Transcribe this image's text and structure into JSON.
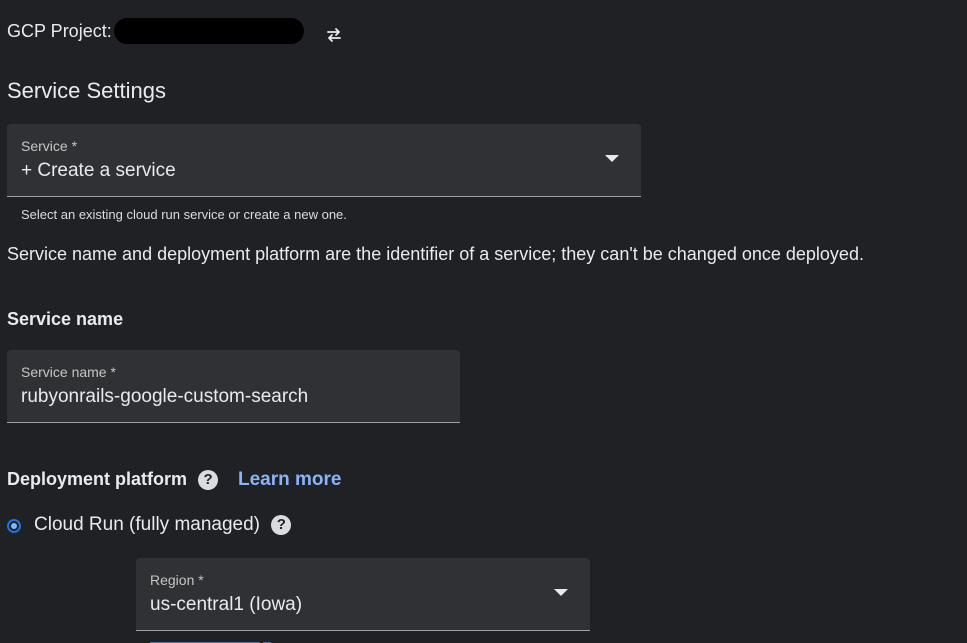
{
  "header": {
    "project_label": "GCP Project:"
  },
  "service_settings": {
    "title": "Service Settings",
    "service_field": {
      "label": "Service *",
      "value": "+ Create a service",
      "helper": "Select an existing cloud run service or create a new one."
    },
    "info": "Service name and deployment platform are the identifier of a service; they can't be changed once deployed."
  },
  "service_name": {
    "heading": "Service name",
    "field_label": "Service name *",
    "field_value": "rubyonrails-google-custom-search"
  },
  "deployment": {
    "heading": "Deployment platform",
    "help_glyph": "?",
    "learn_more": "Learn more",
    "option_label": "Cloud Run (fully managed)",
    "option_selected": true,
    "region_field": {
      "label": "Region *",
      "value": "us-central1 (Iowa)"
    }
  },
  "icons": {
    "switch": "swap-arrows-icon",
    "dropdown": "caret-down-icon",
    "help": "help-circle-icon"
  },
  "colors": {
    "background": "#202124",
    "field": "#303134",
    "link": "#8ab4f8",
    "radio": "#1a73e8"
  }
}
